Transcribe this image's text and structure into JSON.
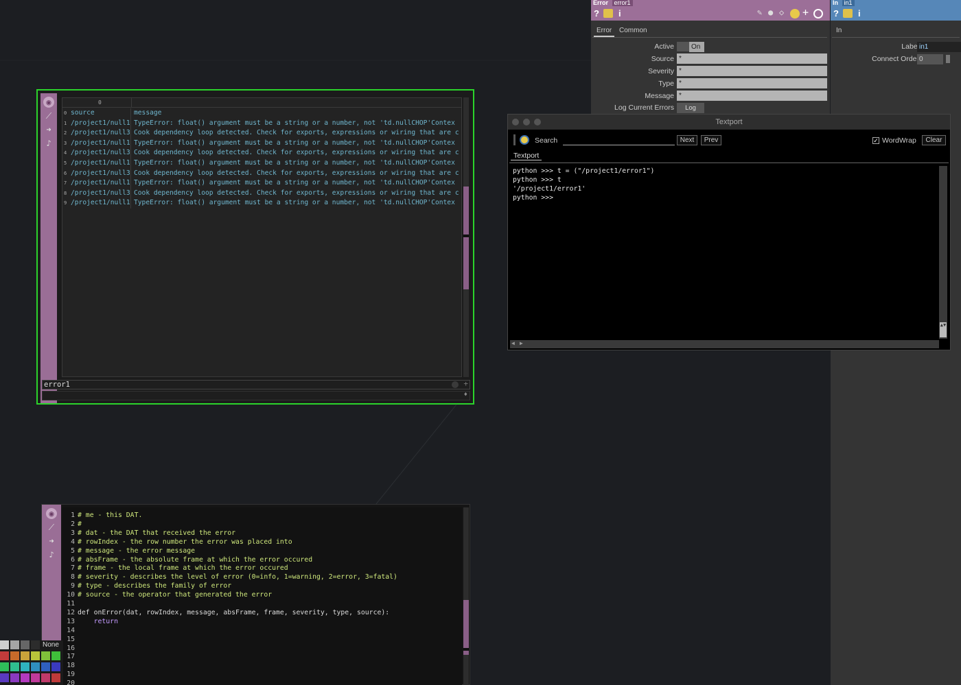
{
  "error_dat": {
    "name": "error1",
    "header_index": "0",
    "columns": [
      "source",
      "message"
    ],
    "rows": [
      {
        "n": "0",
        "source": "source",
        "message": "message"
      },
      {
        "n": "1",
        "source": "/project1/null1",
        "message": "TypeError: float() argument must be a string or a number, not 'td.nullCHOP'Contex"
      },
      {
        "n": "2",
        "source": "/project1/null3",
        "message": "Cook dependency loop detected. Check for exports, expressions or wiring that are c"
      },
      {
        "n": "3",
        "source": "/project1/null1",
        "message": "TypeError: float() argument must be a string or a number, not 'td.nullCHOP'Contex"
      },
      {
        "n": "4",
        "source": "/project1/null3",
        "message": "Cook dependency loop detected. Check for exports, expressions or wiring that are c"
      },
      {
        "n": "5",
        "source": "/project1/null1",
        "message": "TypeError: float() argument must be a string or a number, not 'td.nullCHOP'Contex"
      },
      {
        "n": "6",
        "source": "/project1/null3",
        "message": "Cook dependency loop detected. Check for exports, expressions or wiring that are c"
      },
      {
        "n": "7",
        "source": "/project1/null1",
        "message": "TypeError: float() argument must be a string or a number, not 'td.nullCHOP'Contex"
      },
      {
        "n": "8",
        "source": "/project1/null3",
        "message": "Cook dependency loop detected. Check for exports, expressions or wiring that are c"
      },
      {
        "n": "9",
        "source": "/project1/null1",
        "message": "TypeError: float() argument must be a string or a number, not 'td.nullCHOP'Contex"
      }
    ]
  },
  "callbacks_dat": {
    "lines": [
      {
        "n": "1",
        "text": "# me - this DAT."
      },
      {
        "n": "2",
        "text": "#"
      },
      {
        "n": "3",
        "text": "# dat - the DAT that received the error"
      },
      {
        "n": "4",
        "text": "# rowIndex - the row number the error was placed into"
      },
      {
        "n": "5",
        "text": "# message - the error message"
      },
      {
        "n": "6",
        "text": "# absFrame - the absolute frame at which the error occured"
      },
      {
        "n": "7",
        "text": "# frame - the local frame at which the error occured"
      },
      {
        "n": "8",
        "text": "# severity - describes the level of error (0=info, 1=warning, 2=error, 3=fatal)"
      },
      {
        "n": "9",
        "text": "# type - describes the family of error"
      },
      {
        "n": "10",
        "text": "# source - the operator that generated the error"
      },
      {
        "n": "11",
        "text": ""
      },
      {
        "n": "12",
        "text": "def onError(dat, rowIndex, message, absFrame, frame, severity, type, source):"
      },
      {
        "n": "13",
        "text": "    return"
      },
      {
        "n": "14",
        "text": ""
      },
      {
        "n": "15",
        "text": ""
      },
      {
        "n": "16",
        "text": ""
      },
      {
        "n": "17",
        "text": ""
      },
      {
        "n": "18",
        "text": ""
      },
      {
        "n": "19",
        "text": ""
      },
      {
        "n": "20",
        "text": ""
      }
    ]
  },
  "palette": {
    "none_label": "None",
    "rows": [
      [
        "#cfcfcf",
        "#a5a5a5",
        "#666666",
        "#2c2c2c"
      ],
      [
        "#c23b3b",
        "#c76a2a",
        "#c9a33a",
        "#b8c43a",
        "#7fbf3a",
        "#3fbf3a"
      ],
      [
        "#2fbf5a",
        "#2fbf8f",
        "#2fb3bf",
        "#2f8fbf",
        "#2f5fbf",
        "#3a3abf"
      ],
      [
        "#5a3abf",
        "#8a3abf",
        "#b33abf",
        "#bf3a9a",
        "#bf3a6a",
        "#bf3a3a"
      ]
    ]
  },
  "error_panel": {
    "op_type": "Error",
    "op_name": "error1",
    "header_color": "#9c6f98",
    "tabs": [
      "Error",
      "Common"
    ],
    "params": [
      {
        "label": "Active",
        "value": "On",
        "kind": "toggle"
      },
      {
        "label": "Source",
        "value": "*",
        "kind": "field"
      },
      {
        "label": "Severity",
        "value": "*",
        "kind": "field"
      },
      {
        "label": "Type",
        "value": "*",
        "kind": "field"
      },
      {
        "label": "Message",
        "value": "*",
        "kind": "field"
      },
      {
        "label": "Log Current Errors",
        "value": "Log",
        "kind": "button"
      }
    ]
  },
  "in_panel": {
    "op_type": "In",
    "op_name": "in1",
    "header_color": "#5687b8",
    "tabs": [
      "In"
    ],
    "params": [
      {
        "label": "Label",
        "value": "in1"
      },
      {
        "label": "Connect Order",
        "value": "0"
      }
    ]
  },
  "textport": {
    "title": "Textport",
    "search_label": "Search",
    "next_label": "Next",
    "prev_label": "Prev",
    "wordwrap_label": "WordWrap",
    "wordwrap_checked": true,
    "clear_label": "Clear",
    "tab": "Textport",
    "output": [
      "python >>> t = (\"/project1/error1\")",
      "python >>> t",
      "'/project1/error1'",
      "python >>> "
    ]
  }
}
